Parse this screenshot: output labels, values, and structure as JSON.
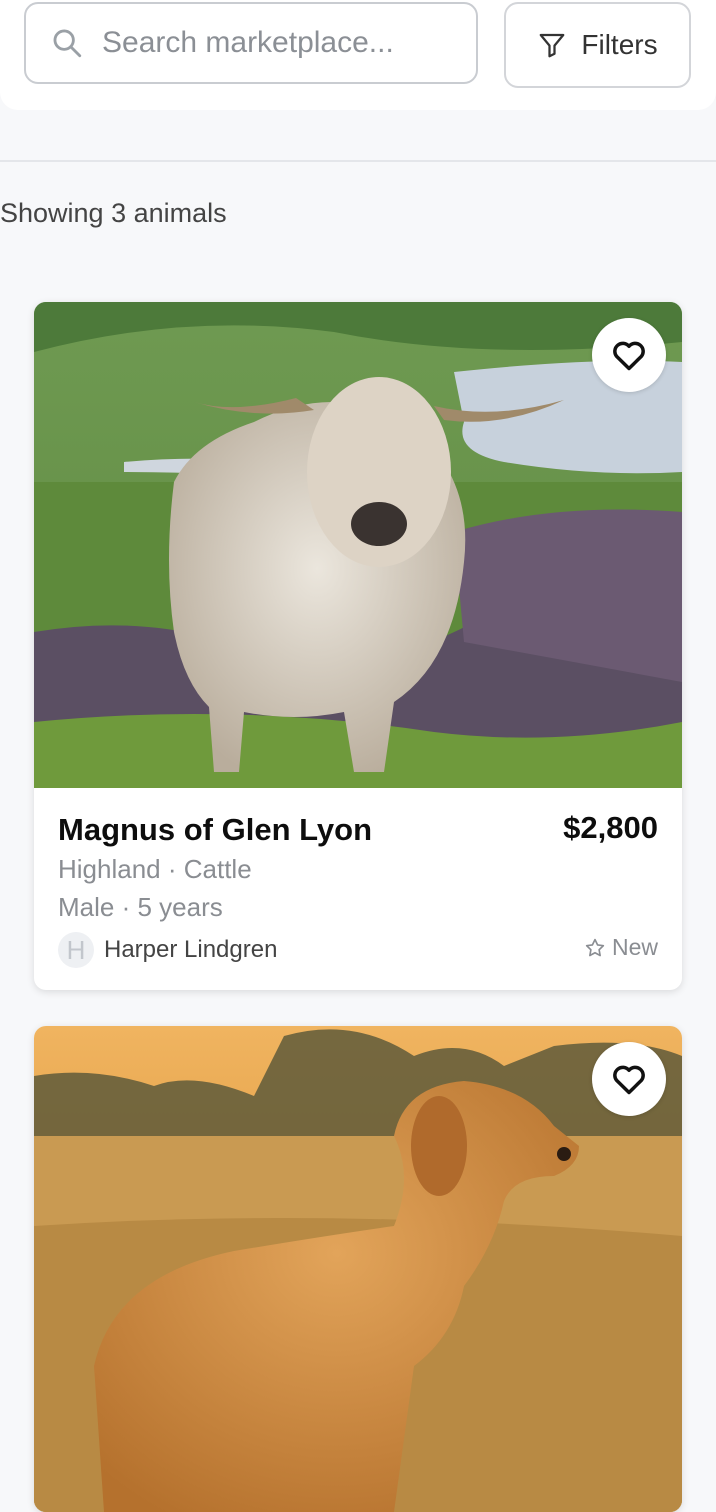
{
  "search": {
    "placeholder": "Search marketplace...",
    "value": ""
  },
  "filters": {
    "label": "Filters"
  },
  "results": {
    "count_text": "Showing 3 animals"
  },
  "listings": [
    {
      "name": "Magnus of Glen Lyon",
      "price": "$2,800",
      "breed": "Highland · Cattle",
      "meta": "Male · 5 years",
      "seller_initial": "H",
      "seller_name": "Harper Lindgren",
      "badge": "New",
      "favorite_icon": "heart-outline-icon"
    },
    {
      "favorite_icon": "heart-outline-icon"
    }
  ],
  "colors": {
    "background": "#f7f8fa",
    "border": "#c9ccd1",
    "muted_text": "#8a8d92"
  }
}
